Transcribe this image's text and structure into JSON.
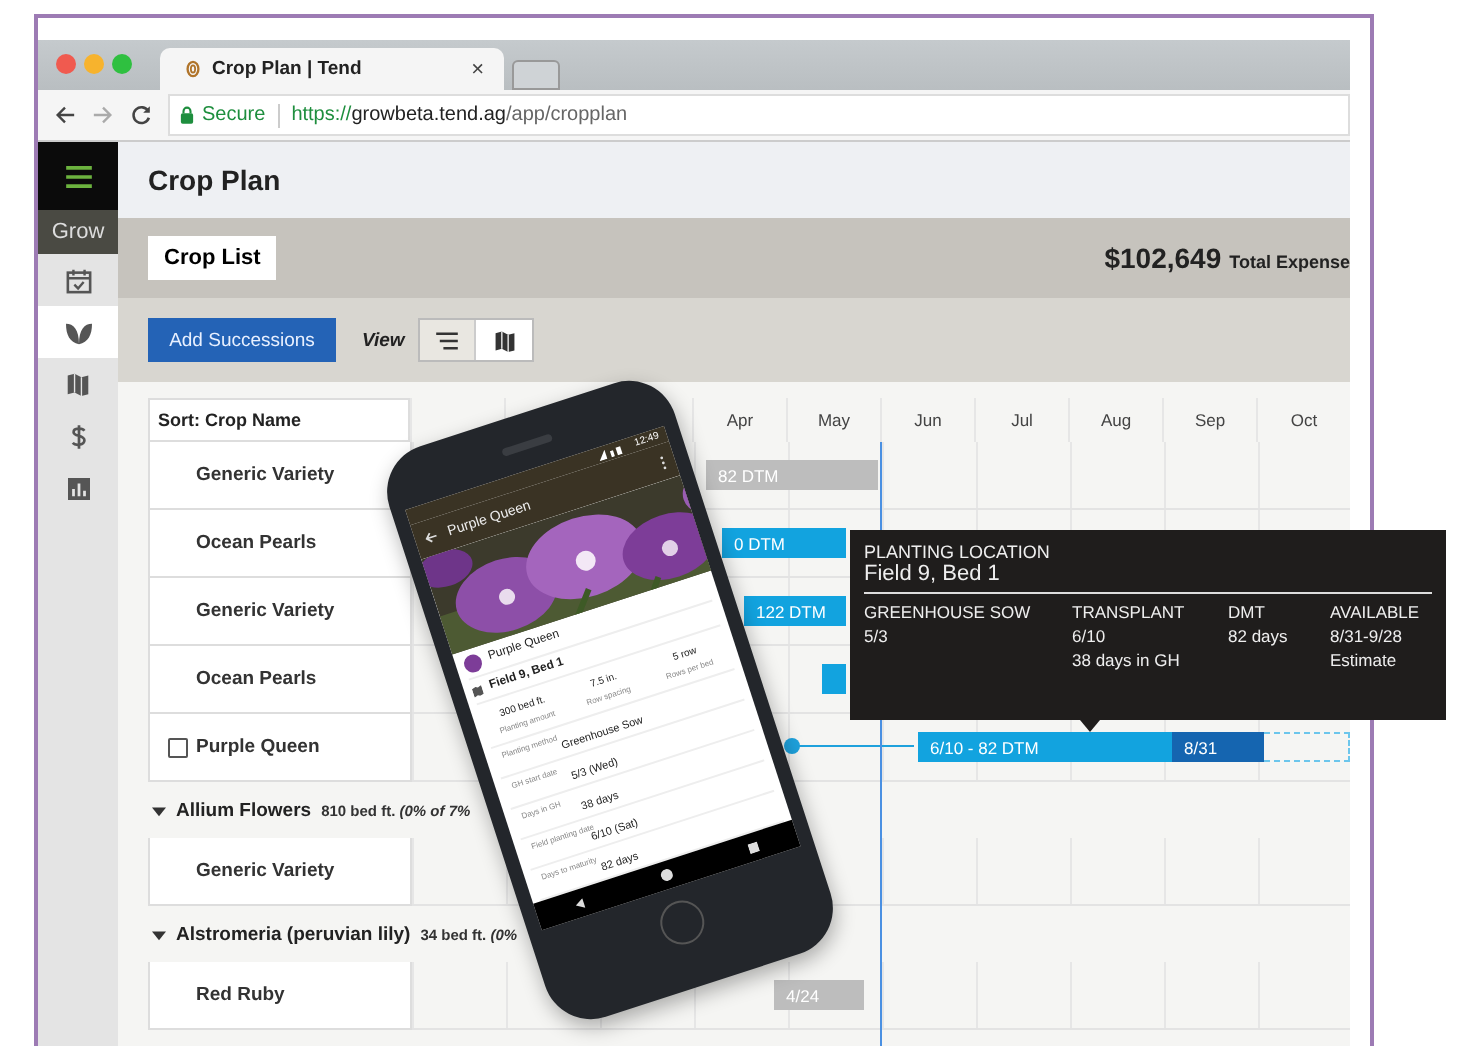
{
  "browser": {
    "tab_title": "Crop Plan | Tend",
    "tab_close": "×",
    "secure_label": "Secure",
    "url": {
      "scheme": "https://",
      "host": "growbeta.tend.ag",
      "path": "/app/cropplan"
    }
  },
  "sidebar": {
    "section": "Grow",
    "items": [
      {
        "kind": "calendar",
        "selected": false
      },
      {
        "kind": "leaf",
        "selected": true
      },
      {
        "kind": "map",
        "selected": false
      },
      {
        "kind": "dollar",
        "selected": false
      },
      {
        "kind": "chart",
        "selected": false
      }
    ]
  },
  "header": {
    "title": "Crop Plan"
  },
  "toolbar": {
    "crop_list_button": "Crop List",
    "total": "$102,649",
    "total_label": "Total Expense",
    "add_button": "Add Successions",
    "view_label": "View",
    "view_options": [
      {
        "kind": "list",
        "selected": true
      },
      {
        "kind": "map",
        "selected": false
      }
    ]
  },
  "table": {
    "sort_label": "Sort: Crop Name",
    "months": [
      "Apr",
      "May",
      "Jun",
      "Jul",
      "Aug",
      "Sep",
      "Oct"
    ],
    "rows": [
      {
        "kind": "crop",
        "name": "Generic Variety",
        "bar": {
          "kind": "planned",
          "label": "82 DTM"
        }
      },
      {
        "kind": "crop",
        "name": "Ocean Pearls",
        "bar": {
          "kind": "scheduled",
          "label": "0 DTM"
        }
      },
      {
        "kind": "crop",
        "name": "Generic Variety",
        "bar": {
          "kind": "scheduled",
          "label": "122 DTM"
        }
      },
      {
        "kind": "crop",
        "name": "Ocean Pearls",
        "bar": {
          "kind": "scheduled"
        }
      },
      {
        "kind": "crop",
        "name": "Purple Queen",
        "checked": false,
        "bar": {
          "kind": "scheduled",
          "label": "6/10 - 82 DTM",
          "harvest": "8/31"
        }
      },
      {
        "kind": "group",
        "name": "Allium Flowers",
        "summary": "810 bed ft. *(0% of 7%*",
        "expanded": true
      },
      {
        "kind": "crop",
        "name": "Generic Variety"
      },
      {
        "kind": "group",
        "name": "Alstromeria (peruvian lily)",
        "summary": "34 bed ft. *(0%*",
        "expanded": true
      },
      {
        "kind": "crop",
        "name": "Red Ruby",
        "bar": {
          "kind": "planned",
          "label": "4/24"
        }
      }
    ]
  },
  "tooltip": {
    "title": "PLANTING LOCATION",
    "location": "Field 9, Bed 1",
    "columns": [
      {
        "heading": "GREENHOUSE SOW",
        "lines": [
          "5/3"
        ]
      },
      {
        "heading": "TRANSPLANT",
        "lines": [
          "6/10",
          "38 days in GH"
        ]
      },
      {
        "heading": "DMT",
        "lines": [
          "82 days"
        ]
      },
      {
        "heading": "AVAILABLE",
        "lines": [
          "8/31-9/28",
          "Estimate"
        ]
      }
    ]
  },
  "phone": {
    "time": "12:49",
    "title": "Purple Queen",
    "crop_name": "Purple Queen",
    "location": "Field 9, Bed 1",
    "stats": [
      {
        "value": "300 bed ft.",
        "label": "Planting amount"
      },
      {
        "value": "7.5 in.",
        "label": "Row spacing"
      },
      {
        "value": "5 row",
        "label": "Rows per bed"
      }
    ],
    "details": [
      {
        "label": "Planting method",
        "value": "Greenhouse Sow"
      },
      {
        "label": "GH start date",
        "value": "5/3 (Wed)"
      },
      {
        "label": "Days in GH",
        "value": "38 days"
      },
      {
        "label": "Field planting date",
        "value": "6/10 (Sat)"
      },
      {
        "label": "Days to maturity",
        "value": "82 days"
      }
    ]
  }
}
